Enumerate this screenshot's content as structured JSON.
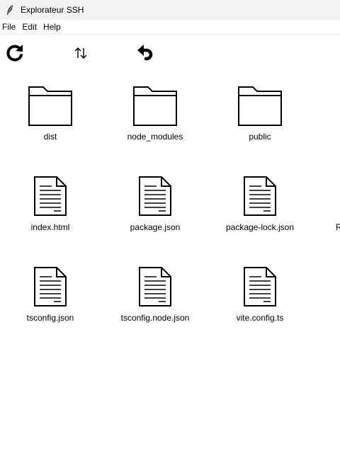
{
  "window": {
    "title": "Explorateur SSH",
    "app_icon": "feather-icon"
  },
  "menubar": {
    "items": [
      "File",
      "Edit",
      "Help"
    ]
  },
  "toolbar": {
    "icons": [
      "refresh-icon",
      "sort-icon",
      "back-icon"
    ]
  },
  "files": [
    {
      "name": "dist",
      "type": "folder"
    },
    {
      "name": "node_modules",
      "type": "folder"
    },
    {
      "name": "public",
      "type": "folder"
    },
    {
      "name": "index.html",
      "type": "file"
    },
    {
      "name": "package.json",
      "type": "file"
    },
    {
      "name": "package-lock.json",
      "type": "file"
    },
    {
      "name": "R",
      "type": "file"
    },
    {
      "name": "tsconfig.json",
      "type": "file"
    },
    {
      "name": "tsconfig.node.json",
      "type": "file"
    },
    {
      "name": "vite.config.ts",
      "type": "file"
    }
  ]
}
